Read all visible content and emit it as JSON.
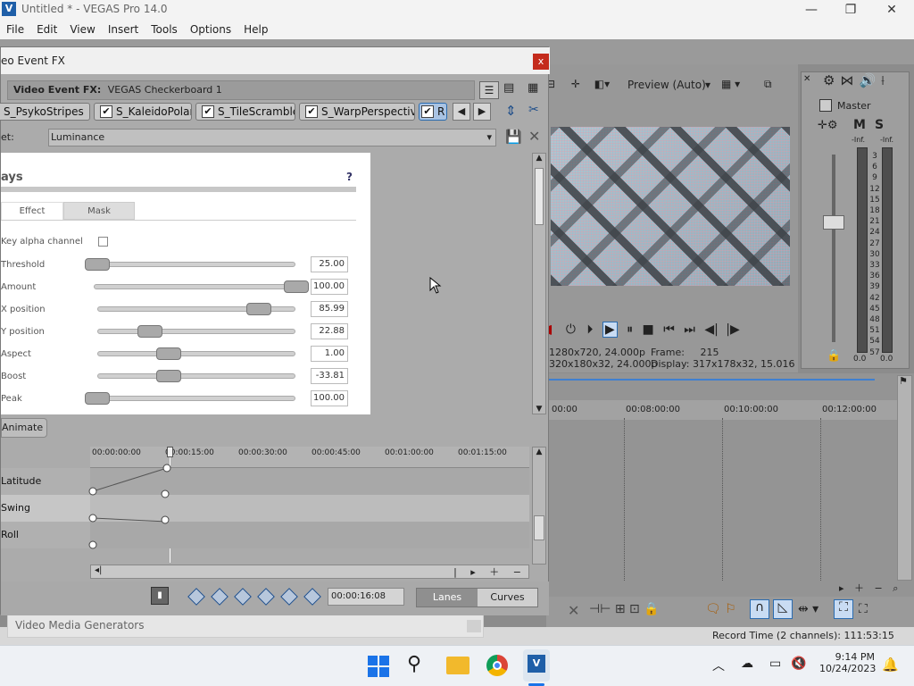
{
  "app": {
    "title": "Untitled * - VEGAS Pro 14.0",
    "icon": "vegas-logo-icon",
    "window_controls": {
      "minimize": "—",
      "maximize": "❐",
      "close": "✕"
    }
  },
  "menu": [
    "File",
    "Edit",
    "View",
    "Insert",
    "Tools",
    "Options",
    "Help"
  ],
  "preview": {
    "quality": "Preview (Auto)",
    "project_line": "1280x720, 24.000p",
    "preview_line": "320x180x32, 24.000p",
    "frame_label": "Frame:",
    "frame_value": "215",
    "display_label": "Display:",
    "display_value": "317x178x32, 15.016"
  },
  "mixer": {
    "master_label": "Master",
    "m": "M",
    "s": "S",
    "inf_left": "-Inf.",
    "inf_right": "-Inf.",
    "scale": [
      "3",
      "6",
      "9",
      "12",
      "15",
      "18",
      "21",
      "24",
      "27",
      "30",
      "33",
      "36",
      "39",
      "42",
      "45",
      "48",
      "51",
      "54",
      "57"
    ],
    "level_left": "0.0",
    "level_right": "0.0"
  },
  "timeline": {
    "ruler": [
      "00:00",
      "00:08:00:00",
      "00:10:00:00",
      "00:12:00:00"
    ]
  },
  "status": {
    "record_time": "Record Time (2 channels): 111:53:15"
  },
  "dialog": {
    "title": "Video Event FX",
    "title_visible": "eo Event FX",
    "close": "x",
    "fx_label": "Video Event FX:",
    "fx_name": "VEGAS Checkerboard 1",
    "chain": [
      "S_PsykoStripes",
      "S_KaleidoPolar",
      "S_TileScramble",
      "S_WarpPerspective",
      "R"
    ],
    "preset_label": "et:",
    "preset_value": "Luminance",
    "panel_title": "ays",
    "help": "?",
    "tabs": {
      "effect": "Effect",
      "mask": "Mask"
    },
    "params": [
      {
        "label": "Key alpha channel",
        "type": "checkbox",
        "checked": false
      },
      {
        "label": "Threshold",
        "value": "25.00",
        "fraction": 0.0
      },
      {
        "label": "Amount",
        "value": "100.00",
        "fraction": 1.0
      },
      {
        "label": "X position",
        "value": "85.99",
        "fraction": 0.86
      },
      {
        "label": "Y position",
        "value": "22.88",
        "fraction": 0.23
      },
      {
        "label": "Aspect",
        "value": "1.00",
        "fraction": 0.34
      },
      {
        "label": "Boost",
        "value": "-33.81",
        "fraction": 0.34
      },
      {
        "label": "Peak",
        "value": "100.00",
        "fraction": 0.0
      }
    ],
    "param_labels_visible": [
      "Key alpha channel",
      "Threshold",
      "Amount",
      "X position",
      "Y position",
      "Aspect",
      "Boost",
      "Peak"
    ],
    "animate": "Animate",
    "kf_ruler": [
      "00:00:00:00",
      "00:00:15:00",
      "00:00:30:00",
      "00:00:45:00",
      "00:01:00:00",
      "00:01:15:00"
    ],
    "kf_lanes": [
      "Latitude",
      "Swing",
      "Roll"
    ],
    "timecode": "00:00:16:08",
    "lanes_btn": "Lanes",
    "curves_btn": "Curves"
  },
  "generators": {
    "label": "Video Media Generators"
  },
  "taskbar": {
    "time": "9:14 PM",
    "date": "10/24/2023"
  }
}
